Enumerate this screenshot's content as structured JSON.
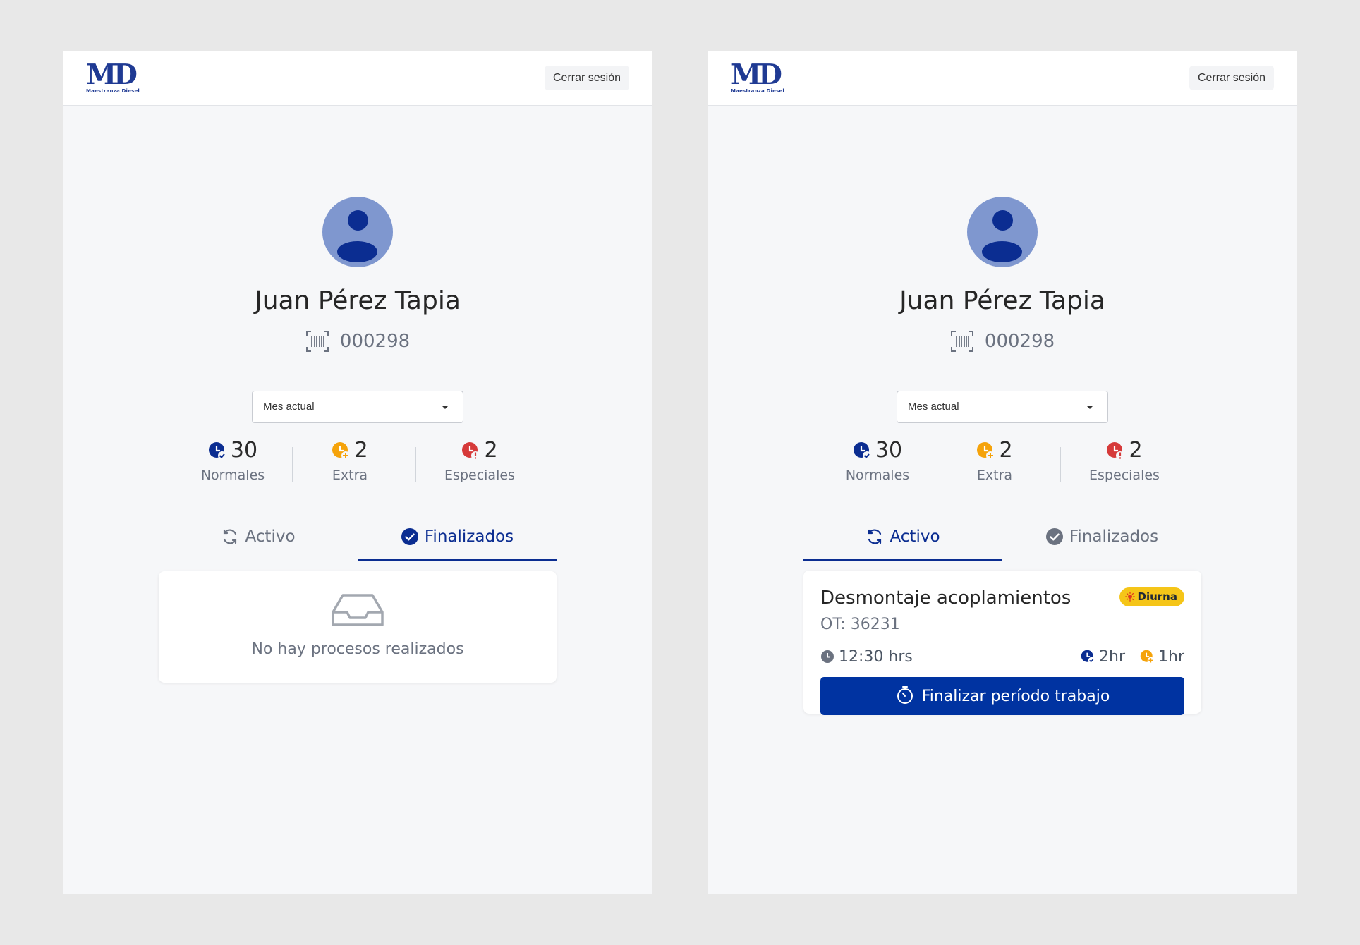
{
  "colors": {
    "background": "#e8e8e8",
    "screen_bg": "#f6f7f9",
    "brand_blue": "#0b2d91",
    "button_blue": "#0033a1",
    "extra_orange": "#f5a30b",
    "special_red": "#d63a3a",
    "badge_yellow": "#f5c518",
    "muted_text": "#6b7280"
  },
  "brand": {
    "mark": "MD",
    "subtitle": "Maestranza Diesel"
  },
  "header": {
    "logout_label": "Cerrar sesión"
  },
  "profile": {
    "name": "Juan Pérez Tapia",
    "code": "000298",
    "code_icon": "barcode-scan-icon",
    "avatar_icon": "user-avatar-icon"
  },
  "filter": {
    "selected": "Mes actual",
    "icon": "chevron-down-icon"
  },
  "stats": {
    "normales": {
      "value": "30",
      "label": "Normales",
      "icon": "clock-check-icon"
    },
    "extra": {
      "value": "2",
      "label": "Extra",
      "icon": "clock-plus-icon"
    },
    "especiales": {
      "value": "2",
      "label": "Especiales",
      "icon": "clock-alert-icon"
    }
  },
  "tabs": {
    "activo": {
      "label": "Activo",
      "icon": "refresh-icon"
    },
    "finalizados": {
      "label": "Finalizados",
      "icon": "check-circle-icon"
    }
  },
  "screens": {
    "left": {
      "active_tab": "finalizados"
    },
    "right": {
      "active_tab": "activo"
    }
  },
  "empty_state": {
    "message": "No hay procesos realizados",
    "icon": "inbox-tray-icon"
  },
  "process": {
    "title": "Desmontaje acoplamientos",
    "badge": "Diurna",
    "badge_icon": "sun-icon",
    "ot": "OT: 36231",
    "time": "12:30 hrs",
    "normal_hours": "2hr",
    "extra_hours": "1hr",
    "button_label": "Finalizar período trabajo",
    "button_icon": "stopwatch-icon"
  }
}
